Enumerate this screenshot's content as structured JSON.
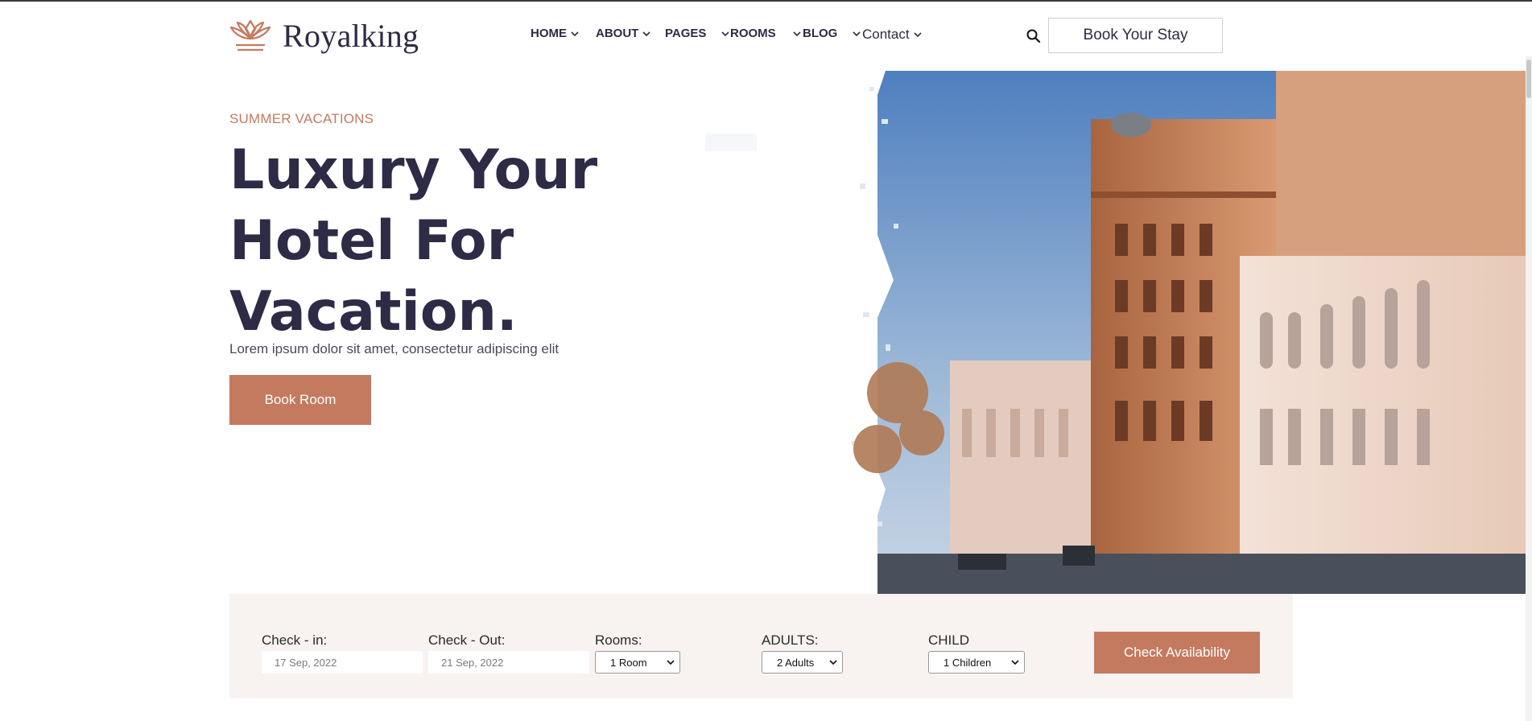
{
  "brand": {
    "name": "Royalking",
    "logo_icon": "crown-lotus-icon",
    "accent": "#c47a5f",
    "dark": "#2d2b45"
  },
  "nav": {
    "items": [
      {
        "label": "HOME"
      },
      {
        "label": "ABOUT"
      },
      {
        "label": "PAGES"
      },
      {
        "label": "ROOMS"
      },
      {
        "label": "BLOG"
      },
      {
        "label": "Contact"
      }
    ],
    "search_icon": "search-icon",
    "cta_label": "Book Your Stay"
  },
  "hero": {
    "eyebrow": "SUMMER VACATIONS",
    "headline_lines": [
      "Luxury Your",
      "Hotel For",
      "Vacation."
    ],
    "subtext": "Lorem ipsum dolor sit amet, consectetur adipiscing elit",
    "button_label": "Book Room",
    "image": "hotel-buildings-photo"
  },
  "booking": {
    "check_in": {
      "label": "Check - in:",
      "value": "17 Sep, 2022"
    },
    "check_out": {
      "label": "Check - Out:",
      "value": "21 Sep, 2022"
    },
    "rooms": {
      "label": "Rooms:",
      "value": "1 Room"
    },
    "adults": {
      "label": "ADULTS:",
      "value": "2 Adults"
    },
    "child": {
      "label": "CHILD",
      "value": "1 Children"
    },
    "button_label": "Check Availability"
  }
}
